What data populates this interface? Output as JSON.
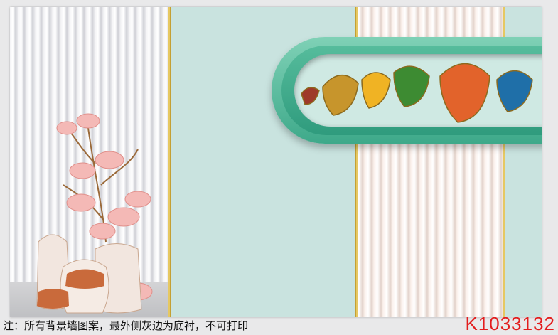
{
  "caption": "注：所有背景墙图案，最外侧灰边为底衬，不可打印",
  "product_code": "K1033132",
  "colors": {
    "background": "#e9e9ea",
    "mint_wall": "#c9e3df",
    "capsule_green": "#3ea98a",
    "gold": "#e2c04a",
    "code_red": "#e31d1d"
  },
  "icons": [
    "magnolia-vase-illustration",
    "ginkgo-leaf-illustration"
  ]
}
